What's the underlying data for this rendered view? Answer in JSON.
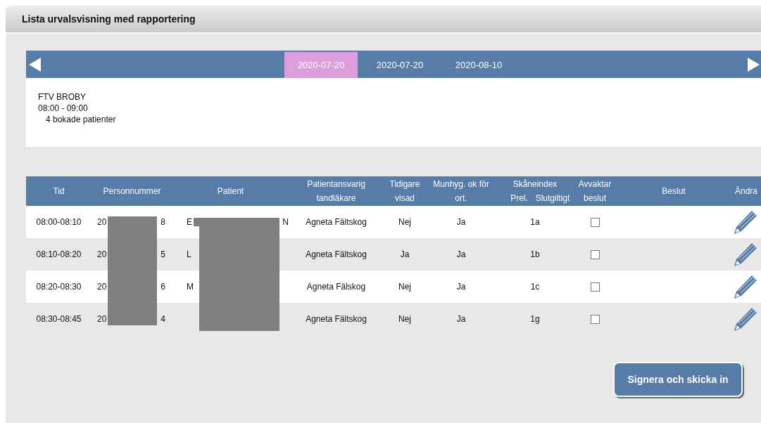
{
  "panel": {
    "title": "Lista urvalsvisning med rapportering"
  },
  "date_tabs": [
    {
      "label": "2020-07-20",
      "selected": true
    },
    {
      "label": "2020-07-20",
      "selected": false
    },
    {
      "label": "2020-08-10",
      "selected": false
    }
  ],
  "info": {
    "clinic": "FTV BROBY",
    "time": "08:00 - 09:00",
    "booked": "4 bokade patienter"
  },
  "table": {
    "columns": {
      "tid": "Tid",
      "personnummer": "Personnummer",
      "patient": "Patient",
      "dentist": [
        "Patientansvarig",
        "tandläkare"
      ],
      "previously_shown": [
        "Tidigare",
        "visad"
      ],
      "oral_hygiene": [
        "Munhyg. ok för",
        "ort."
      ],
      "skaneindex": "Skåneindex",
      "skaneindex_sub": [
        "Prel.",
        "Slutgiltigt"
      ],
      "awaiting": [
        "Avvaktar",
        "beslut"
      ],
      "decision": "Beslut",
      "edit": "Ändra"
    },
    "rows": [
      {
        "tid": "08:00-08:10",
        "personnummer": [
          "20",
          "8"
        ],
        "patient": [
          "E",
          "N"
        ],
        "dentist": "Agneta Fältskog",
        "previously_shown": "Nej",
        "oral_hygiene": "Ja",
        "skaneindex": "1a",
        "awaiting": false
      },
      {
        "tid": "08:10-08:20",
        "personnummer": [
          "20",
          "5"
        ],
        "patient": [
          "L"
        ],
        "dentist": "Agneta Fältskog",
        "previously_shown": "Ja",
        "oral_hygiene": "Ja",
        "skaneindex": "1b",
        "awaiting": false
      },
      {
        "tid": "08:20-08:30",
        "personnummer": [
          "20",
          "6"
        ],
        "patient": [
          "M"
        ],
        "dentist": "Agneta Fälskog",
        "previously_shown": "Nej",
        "oral_hygiene": "Ja",
        "skaneindex": "1c",
        "awaiting": false
      },
      {
        "tid": "08:30-08:45",
        "personnummer": [
          "20",
          "4"
        ],
        "patient": [],
        "dentist": "Agneta Fältskog",
        "previously_shown": "Nej",
        "oral_hygiene": "Ja",
        "skaneindex": "1g",
        "awaiting": false
      }
    ]
  },
  "submit_button": "Signera och skicka in"
}
